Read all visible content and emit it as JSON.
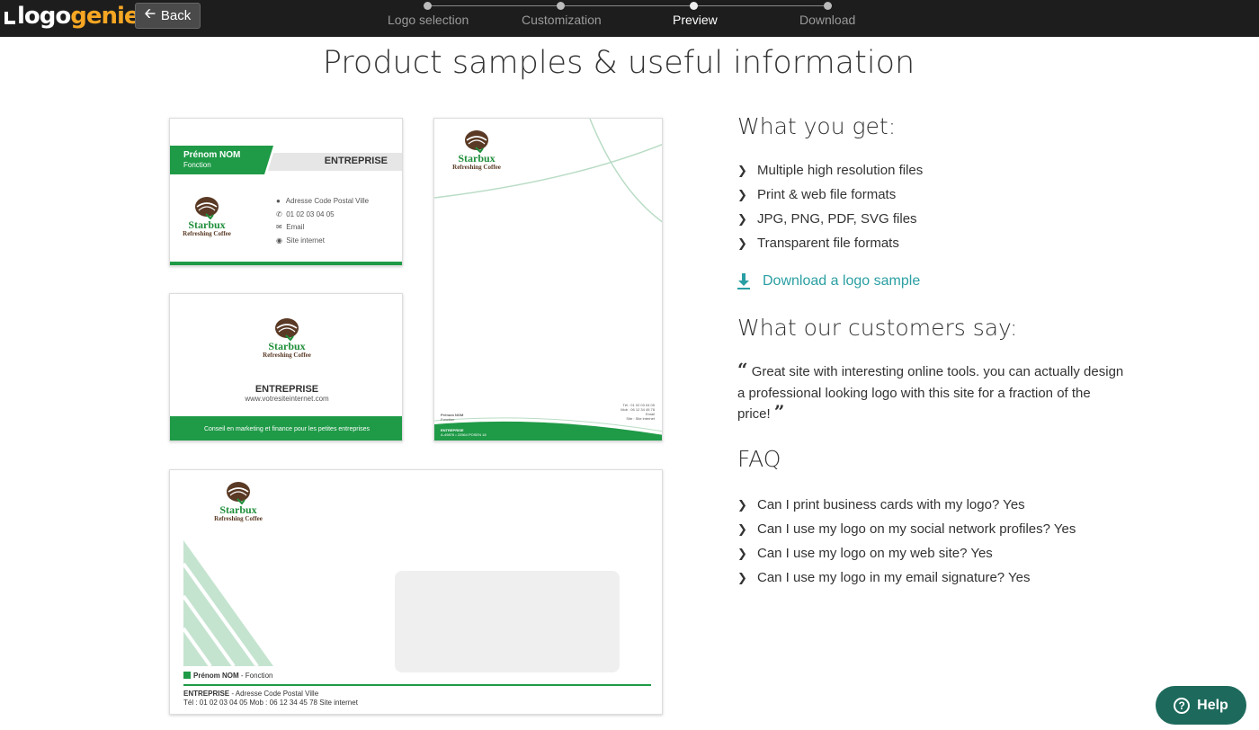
{
  "header": {
    "logo_part1": "logo",
    "logo_part2": "genie",
    "back_label": "Back",
    "steps": [
      {
        "label": "Logo selection",
        "active": false
      },
      {
        "label": "Customization",
        "active": false
      },
      {
        "label": "Preview",
        "active": true
      },
      {
        "label": "Download",
        "active": false
      }
    ]
  },
  "title": "Product samples & useful information",
  "business_card": {
    "name": "Prénom NOM",
    "role": "Fonction",
    "company": "ENTREPRISE",
    "address": "Adresse Code Postal Ville",
    "phone": "01 02 03 04 05",
    "email": "Email",
    "site": "Site internet",
    "brand": "Starbux",
    "tagline": "Refreshing Coffee"
  },
  "card_back": {
    "brand": "Starbux",
    "tagline": "Refreshing Coffee",
    "company": "ENTREPRISE",
    "website": "www.votresiteinternet.com",
    "slogan": "Conseil en marketing et finance pour les petites entreprises"
  },
  "letterhead": {
    "brand": "Starbux",
    "tagline": "Refreshing Coffee",
    "name": "Prénom NOM",
    "role": "Fonction",
    "tel": "Tél : 01 02 03 04 05",
    "mob": "Mob : 06 12 34 45 78",
    "email": "Email",
    "site": "Site : Site internet",
    "company": "ENTREPRISE",
    "footer_id": "A-49876 • 22564 POSEN 18"
  },
  "envelope": {
    "brand": "Starbux",
    "tagline": "Refreshing Coffee",
    "name": "Prénom NOM",
    "role": " - Fonction",
    "company": "ENTREPRISE",
    "address": " - Adresse Code Postal Ville",
    "contact": "Tél : 01 02 03 04 05 Mob : 06 12 34 45 78 Site internet"
  },
  "what_you_get": {
    "title": "What you get:",
    "items": [
      "Multiple high resolution files",
      "Print & web file formats",
      "JPG, PNG, PDF, SVG files",
      "Transparent file formats"
    ],
    "download_label": "Download a logo sample"
  },
  "customers": {
    "title": "What our customers say:",
    "quote": "Great site with interesting online tools. you can actually design a professional looking logo with this site for a fraction of the price!"
  },
  "faq": {
    "title": "FAQ",
    "items": [
      "Can I print business cards with my logo? Yes",
      "Can I use my logo on my social network profiles? Yes",
      "Can I use my logo on my web site? Yes",
      "Can I use my logo in my email signature? Yes"
    ]
  },
  "help_label": "Help",
  "colors": {
    "accent_green": "#1f9a47",
    "link_teal": "#2a9fa3",
    "logo_orange": "#f5a623",
    "help_bg": "#1d6a5c"
  }
}
